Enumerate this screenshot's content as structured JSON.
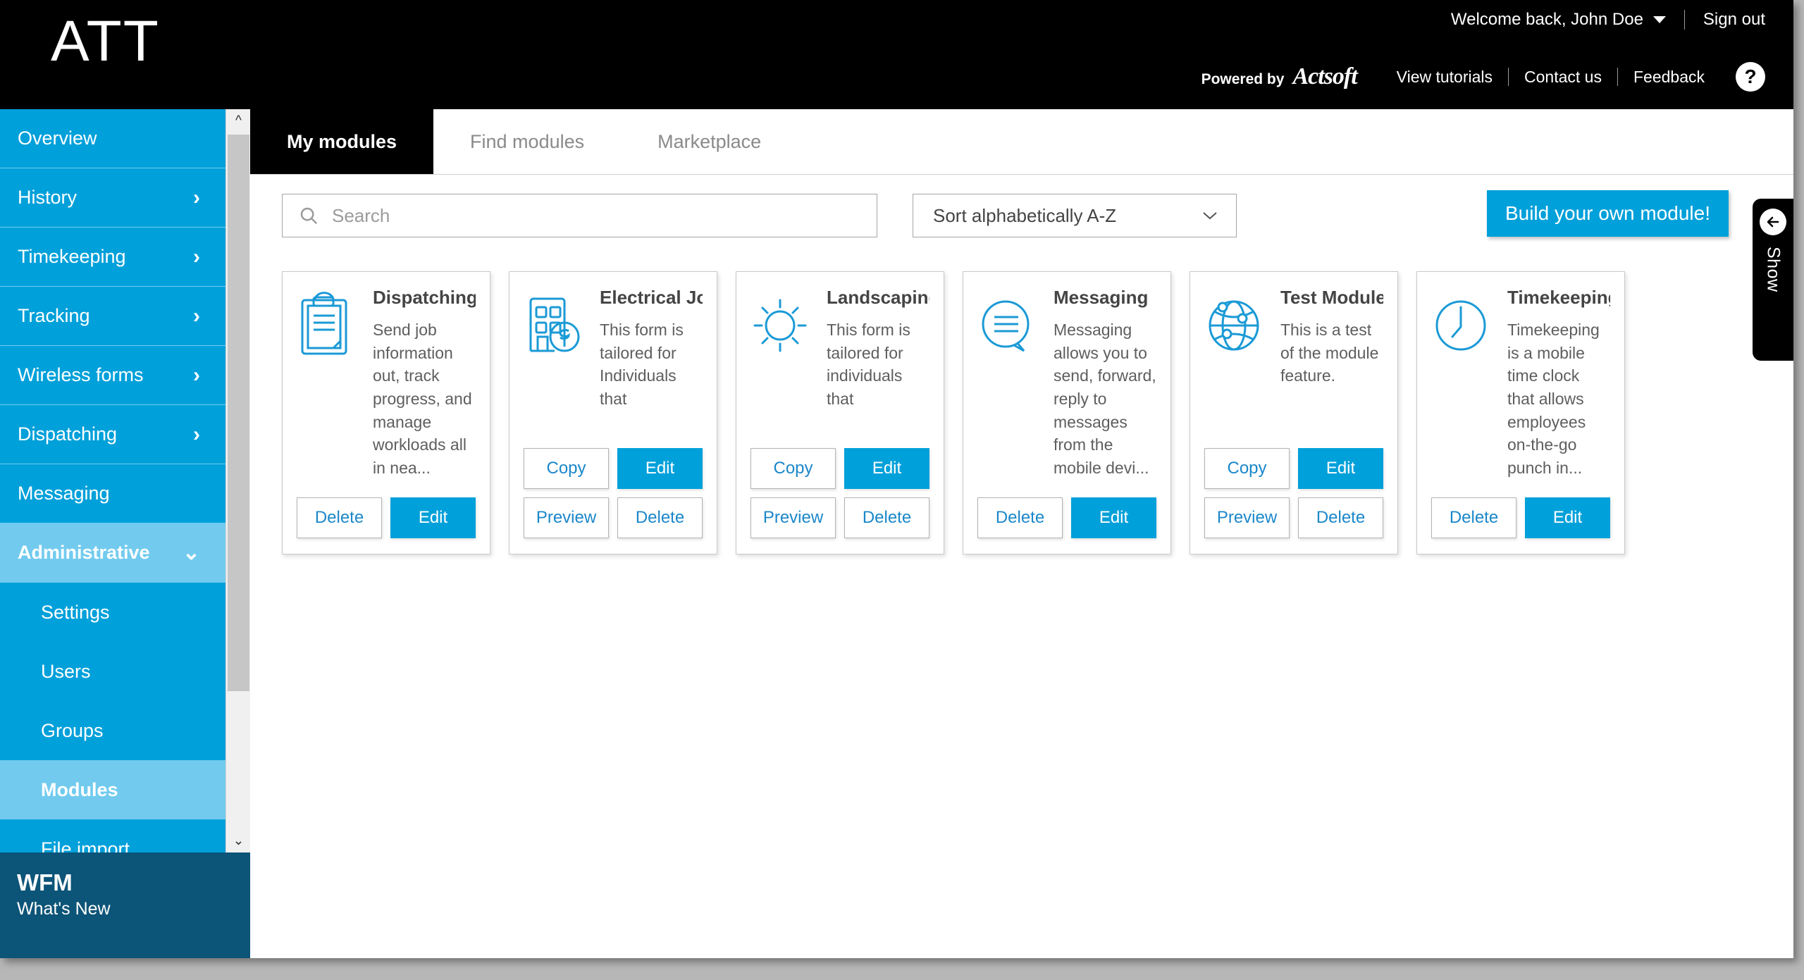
{
  "header": {
    "logo": "ATT",
    "welcome": "Welcome back, John Doe",
    "sign_out": "Sign out",
    "powered_by": "Powered by",
    "brand": "Actsoft",
    "links": [
      "View tutorials",
      "Contact us",
      "Feedback"
    ],
    "help_glyph": "?"
  },
  "sidebar": {
    "items": [
      {
        "label": "Overview",
        "expandable": false
      },
      {
        "label": "History",
        "expandable": true
      },
      {
        "label": "Timekeeping",
        "expandable": true
      },
      {
        "label": "Tracking",
        "expandable": true
      },
      {
        "label": "Wireless forms",
        "expandable": true
      },
      {
        "label": "Dispatching",
        "expandable": true
      },
      {
        "label": "Messaging",
        "expandable": false
      },
      {
        "label": "Administrative",
        "expandable": true,
        "expanded": true
      }
    ],
    "sub_items": [
      {
        "label": "Settings",
        "active": false
      },
      {
        "label": "Users",
        "active": false
      },
      {
        "label": "Groups",
        "active": false
      },
      {
        "label": "Modules",
        "active": true
      },
      {
        "label": "File import",
        "active": false
      }
    ],
    "footer": {
      "title": "WFM",
      "subtitle": "What's New"
    }
  },
  "tabs": [
    {
      "label": "My modules",
      "active": true
    },
    {
      "label": "Find modules",
      "active": false
    },
    {
      "label": "Marketplace",
      "active": false
    }
  ],
  "toolbar": {
    "search_placeholder": "Search",
    "sort_value": "Sort alphabetically A-Z",
    "build_label": "Build your own module!"
  },
  "show_panel": {
    "label": "Show"
  },
  "cards": [
    {
      "title": "Dispatching",
      "description": "Send job information out, track progress, and manage workloads all in nea...",
      "icon": "clipboard-icon",
      "buttons": [
        {
          "label": "Delete",
          "primary": false
        },
        {
          "label": "Edit",
          "primary": true
        }
      ]
    },
    {
      "title": "Electrical Job E...",
      "description": "This form is tailored for Individuals that",
      "icon": "building-dollar-icon",
      "buttons": [
        {
          "label": "Copy",
          "primary": false
        },
        {
          "label": "Edit",
          "primary": true
        },
        {
          "label": "Preview",
          "primary": false
        },
        {
          "label": "Delete",
          "primary": false
        }
      ]
    },
    {
      "title": "Landscaping Jo...",
      "description": "This form is tailored for individuals that",
      "icon": "sun-icon",
      "buttons": [
        {
          "label": "Copy",
          "primary": false
        },
        {
          "label": "Edit",
          "primary": true
        },
        {
          "label": "Preview",
          "primary": false
        },
        {
          "label": "Delete",
          "primary": false
        }
      ]
    },
    {
      "title": "Messaging",
      "description": "Messaging allows you to send, forward, reply to messages from the mobile devi...",
      "icon": "speech-bubble-icon",
      "buttons": [
        {
          "label": "Delete",
          "primary": false
        },
        {
          "label": "Edit",
          "primary": true
        }
      ]
    },
    {
      "title": "Test Module",
      "description": "This is a test of the module feature.",
      "icon": "globe-network-icon",
      "buttons": [
        {
          "label": "Copy",
          "primary": false
        },
        {
          "label": "Edit",
          "primary": true
        },
        {
          "label": "Preview",
          "primary": false
        },
        {
          "label": "Delete",
          "primary": false
        }
      ]
    },
    {
      "title": "Timekeeping",
      "description": "Timekeeping is a mobile time clock that allows employees on-the-go punch in...",
      "icon": "clock-icon",
      "buttons": [
        {
          "label": "Delete",
          "primary": false
        },
        {
          "label": "Edit",
          "primary": true
        }
      ]
    }
  ],
  "colors": {
    "accent": "#00a0da",
    "accent_light": "#72cbee",
    "header_bg": "#000000",
    "footer_bg": "#0c5478",
    "link_blue": "#1b87c9"
  }
}
